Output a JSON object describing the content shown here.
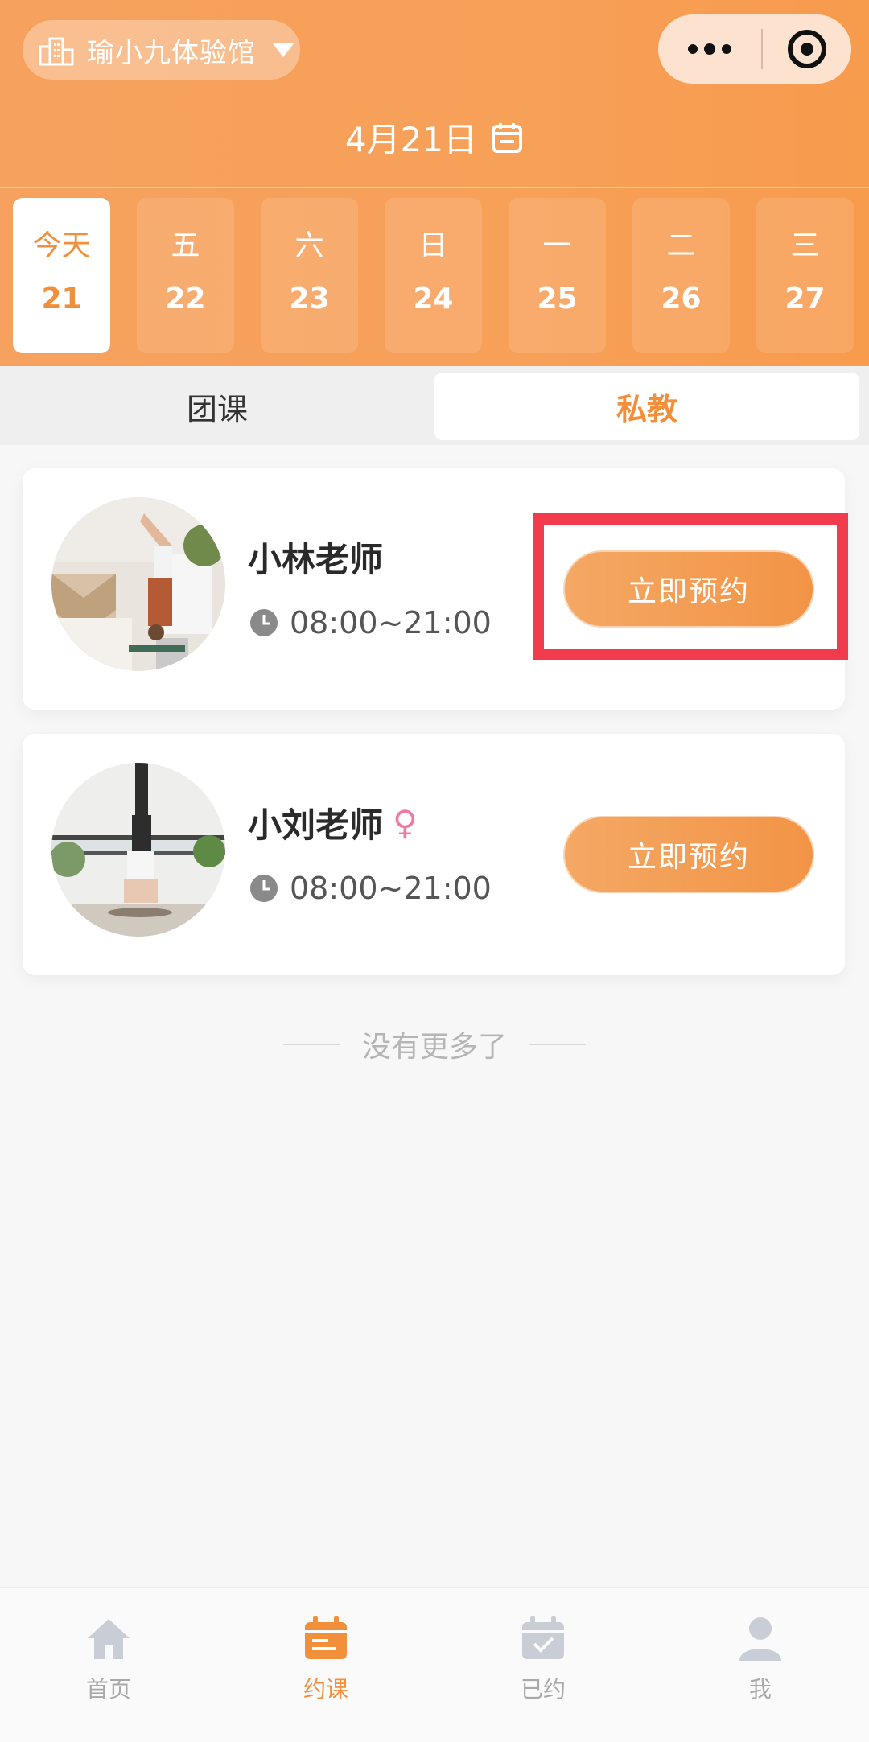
{
  "header": {
    "store_name": "瑜小九体验馆",
    "date_title": "4月21日",
    "gradient_colors": [
      "#f6a15e",
      "#f79b4d"
    ]
  },
  "days": [
    {
      "weekday": "今天",
      "day": "21",
      "active": true
    },
    {
      "weekday": "五",
      "day": "22",
      "active": false
    },
    {
      "weekday": "六",
      "day": "23",
      "active": false
    },
    {
      "weekday": "日",
      "day": "24",
      "active": false
    },
    {
      "weekday": "一",
      "day": "25",
      "active": false
    },
    {
      "weekday": "二",
      "day": "26",
      "active": false
    },
    {
      "weekday": "三",
      "day": "27",
      "active": false
    }
  ],
  "tabs": {
    "group": "团课",
    "private": "私教",
    "selected": "私教"
  },
  "teachers": [
    {
      "name": "小林老师",
      "time": "08:00~21:00",
      "button": "立即预约",
      "gender_icon": ""
    },
    {
      "name": "小刘老师",
      "time": "08:00~21:00",
      "button": "立即预约",
      "gender_icon": "♀"
    }
  ],
  "list_end": "没有更多了",
  "nav": {
    "items": [
      {
        "label": "首页",
        "icon": "home-icon",
        "active": false
      },
      {
        "label": "约课",
        "icon": "calendar-icon",
        "active": true
      },
      {
        "label": "已约",
        "icon": "booked-icon",
        "active": false
      },
      {
        "label": "我",
        "icon": "user-icon",
        "active": false
      }
    ]
  },
  "colors": {
    "accent": "#f28f3b",
    "highlight_box": "#f23c4d"
  }
}
